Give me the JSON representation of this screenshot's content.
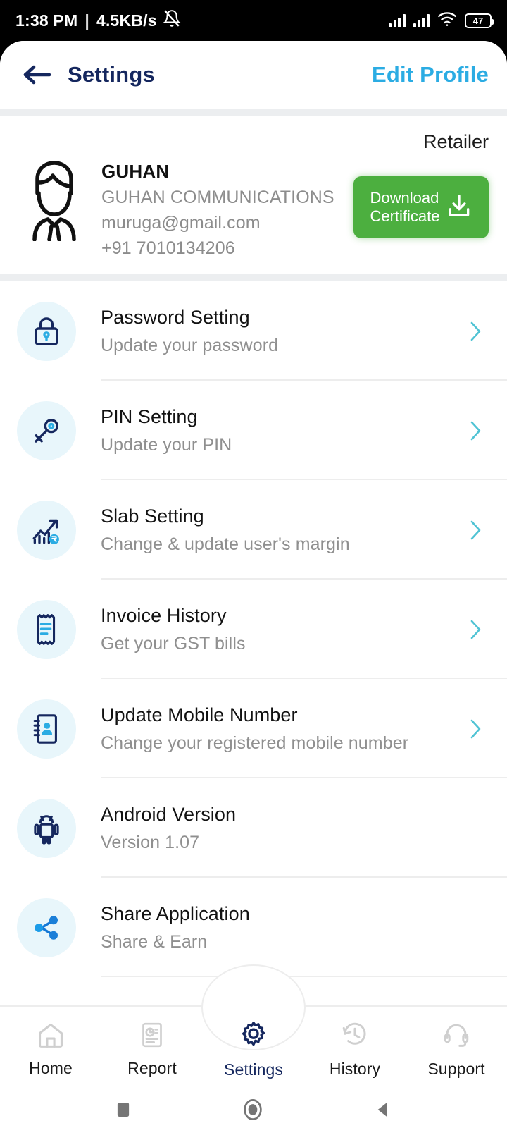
{
  "statusbar": {
    "time": "1:38 PM",
    "separator": "|",
    "network_speed": "4.5KB/s",
    "mute_icon": "bell-mute-icon",
    "signal_icon_1": "signal-bars-icon",
    "signal_icon_2": "signal-bars-icon",
    "wifi_icon": "wifi-icon",
    "battery_level": "47"
  },
  "topbar": {
    "back_icon": "back-arrow-icon",
    "title": "Settings",
    "edit_profile_label": "Edit Profile",
    "title_color": "#15275e",
    "accent_color": "#2BACE3"
  },
  "profile": {
    "role": "Retailer",
    "avatar_icon": "user-avatar-icon",
    "name": "GUHAN",
    "business": "GUHAN COMMUNICATIONS",
    "email": "muruga@gmail.com",
    "phone": "+91 7010134206",
    "download_button": {
      "line1": "Download",
      "line2": "Certificate",
      "icon": "download-icon",
      "color": "#4CAF3F"
    }
  },
  "settings_list": [
    {
      "icon": "lock-icon",
      "title": "Password Setting",
      "subtitle": "Update your password",
      "has_chevron": true
    },
    {
      "icon": "key-icon",
      "title": "PIN Setting",
      "subtitle": "Update your PIN",
      "has_chevron": true
    },
    {
      "icon": "growth-chart-rupee-icon",
      "title": "Slab Setting",
      "subtitle": "Change & update user's margin",
      "has_chevron": true
    },
    {
      "icon": "receipt-icon",
      "title": "Invoice History",
      "subtitle": "Get your GST bills",
      "has_chevron": true
    },
    {
      "icon": "contact-book-icon",
      "title": "Update Mobile Number",
      "subtitle": "Change your registered mobile number",
      "has_chevron": true
    },
    {
      "icon": "android-robot-icon",
      "title": "Android Version",
      "subtitle": "Version 1.07",
      "has_chevron": false
    },
    {
      "icon": "share-nodes-icon",
      "title": "Share Application",
      "subtitle": "Share & Earn",
      "has_chevron": false
    }
  ],
  "bottom_nav": {
    "items": [
      {
        "icon": "home-icon",
        "label": "Home",
        "active": false
      },
      {
        "icon": "report-icon",
        "label": "Report",
        "active": false
      },
      {
        "icon": "gear-icon",
        "label": "Settings",
        "active": true
      },
      {
        "icon": "history-clock-icon",
        "label": "History",
        "active": false
      },
      {
        "icon": "headset-support-icon",
        "label": "Support",
        "active": false
      }
    ],
    "active_color": "#15275e",
    "inactive_color": "#cfcfcf"
  },
  "android_nav": {
    "recents_icon": "square-recents-icon",
    "home_icon": "circle-home-icon",
    "back_icon": "triangle-back-icon"
  }
}
